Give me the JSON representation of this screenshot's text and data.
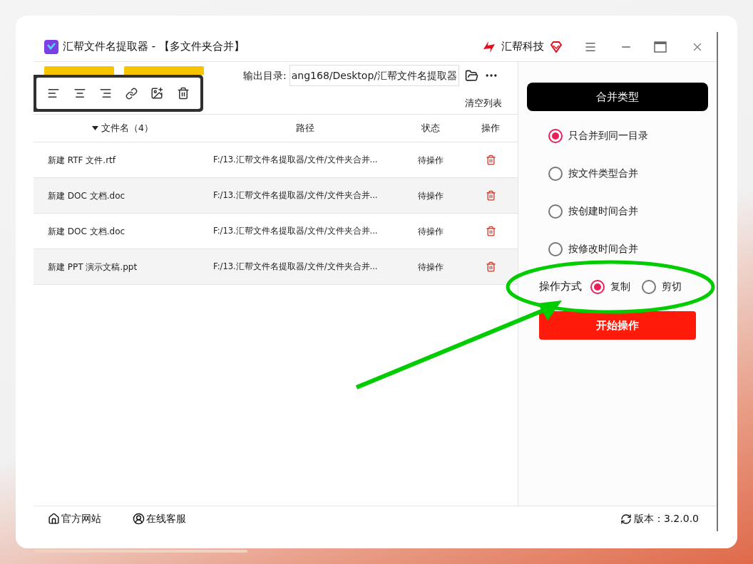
{
  "window": {
    "title": "汇帮文件名提取器 - 【多文件夹合并】",
    "brand": "汇帮科技"
  },
  "output_dir": {
    "label": "输出目录:",
    "value": "ang168/Desktop/汇帮文件名提取器"
  },
  "clear_list": "清空列表",
  "table": {
    "columns": [
      {
        "label": "文件名（4）",
        "sorted": true
      },
      {
        "label": "路径",
        "sorted": false
      },
      {
        "label": "状态",
        "sorted": false
      },
      {
        "label": "操作",
        "sorted": false
      }
    ],
    "rows": [
      {
        "name": "新建 RTF 文件.rtf",
        "path": "F:/13.汇帮文件名提取器/文件/文件夹合并...",
        "status": "待操作"
      },
      {
        "name": "新建 DOC 文档.doc",
        "path": "F:/13.汇帮文件名提取器/文件/文件夹合并...",
        "status": "待操作"
      },
      {
        "name": "新建 DOC 文档.doc",
        "path": "F:/13.汇帮文件名提取器/文件/文件夹合并...",
        "status": "待操作"
      },
      {
        "name": "新建 PPT 演示文稿.ppt",
        "path": "F:/13.汇帮文件名提取器/文件/文件夹合并...",
        "status": "待操作"
      }
    ]
  },
  "merge_panel": {
    "title": "合并类型",
    "options": [
      {
        "label": "只合并到同一目录",
        "selected": true
      },
      {
        "label": "按文件类型合并",
        "selected": false
      },
      {
        "label": "按创建时间合并",
        "selected": false
      },
      {
        "label": "按修改时间合并",
        "selected": false
      }
    ],
    "operation": {
      "label": "操作方式",
      "options": [
        {
          "label": "复制",
          "selected": true
        },
        {
          "label": "剪切",
          "selected": false
        }
      ]
    },
    "start_button": "开始操作"
  },
  "footer": {
    "links": [
      "官方网站",
      "在线客服"
    ],
    "version": "版本：3.2.0.0"
  }
}
